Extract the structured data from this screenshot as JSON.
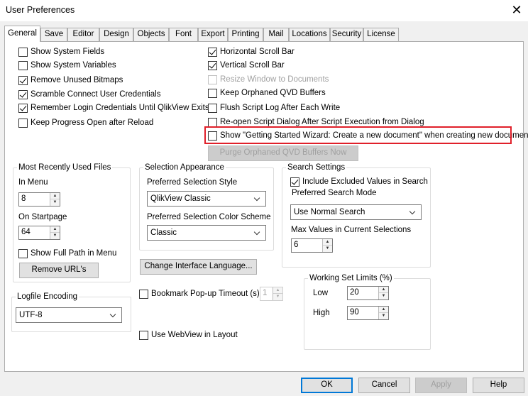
{
  "window": {
    "title": "User Preferences",
    "close_glyph": "✕"
  },
  "tabs": [
    "General",
    "Save",
    "Editor",
    "Design",
    "Objects",
    "Font",
    "Export",
    "Printing",
    "Mail",
    "Locations",
    "Security",
    "License"
  ],
  "left_checks": [
    {
      "label": "Show System Fields",
      "checked": false
    },
    {
      "label": "Show System Variables",
      "checked": false
    },
    {
      "label": "Remove Unused Bitmaps",
      "checked": true
    },
    {
      "label": "Scramble Connect User Credentials",
      "checked": true
    },
    {
      "label": "Remember Login Credentials Until QlikView Exits",
      "checked": true
    },
    {
      "label": "Keep Progress Open after Reload",
      "checked": false
    }
  ],
  "right_checks": [
    {
      "label": "Horizontal Scroll Bar",
      "checked": true
    },
    {
      "label": "Vertical Scroll Bar",
      "checked": true
    },
    {
      "label": "Resize Window to Documents",
      "checked": false,
      "disabled": true
    },
    {
      "label": "Keep Orphaned QVD Buffers",
      "checked": false
    },
    {
      "label": "Flush Script Log After Each Write",
      "checked": false
    },
    {
      "label": "Re-open Script Dialog After Script Execution from Dialog",
      "checked": false
    },
    {
      "label": "Show \"Getting Started Wizard: Create a new document\" when creating new document",
      "checked": false
    }
  ],
  "purge_button": "Purge Orphaned QVD Buffers Now",
  "mru": {
    "title": "Most Recently Used Files",
    "in_menu_label": "In Menu",
    "in_menu_value": "8",
    "on_startpage_label": "On Startpage",
    "on_startpage_value": "64",
    "show_full_path": "Show Full Path in Menu",
    "remove_urls": "Remove URL's"
  },
  "logfile": {
    "title": "Logfile Encoding",
    "value": "UTF-8"
  },
  "selection": {
    "title": "Selection Appearance",
    "style_label": "Preferred Selection Style",
    "style_value": "QlikView Classic",
    "color_label": "Preferred Selection Color Scheme",
    "color_value": "Classic"
  },
  "change_language": "Change Interface Language...",
  "bookmark": {
    "label": "Bookmark Pop-up Timeout (s)",
    "value": "1"
  },
  "webview": "Use WebView in Layout",
  "search": {
    "title": "Search Settings",
    "include_excluded": "Include Excluded Values in Search",
    "mode_label": "Preferred Search Mode",
    "mode_value": "Use Normal Search",
    "max_label": "Max Values in Current Selections",
    "max_value": "6"
  },
  "working_set": {
    "title": "Working Set Limits (%)",
    "low_label": "Low",
    "low_value": "20",
    "high_label": "High",
    "high_value": "90"
  },
  "footer": {
    "ok": "OK",
    "cancel": "Cancel",
    "apply": "Apply",
    "help": "Help"
  },
  "colors": {
    "highlight": "#e0202a",
    "default_button_border": "#0078d7"
  },
  "icons": {
    "close": "close-icon",
    "checkbox": "checkbox-icon",
    "spin_up": "spin-up-icon",
    "spin_down": "spin-down-icon",
    "dropdown": "chevron-down-icon"
  }
}
